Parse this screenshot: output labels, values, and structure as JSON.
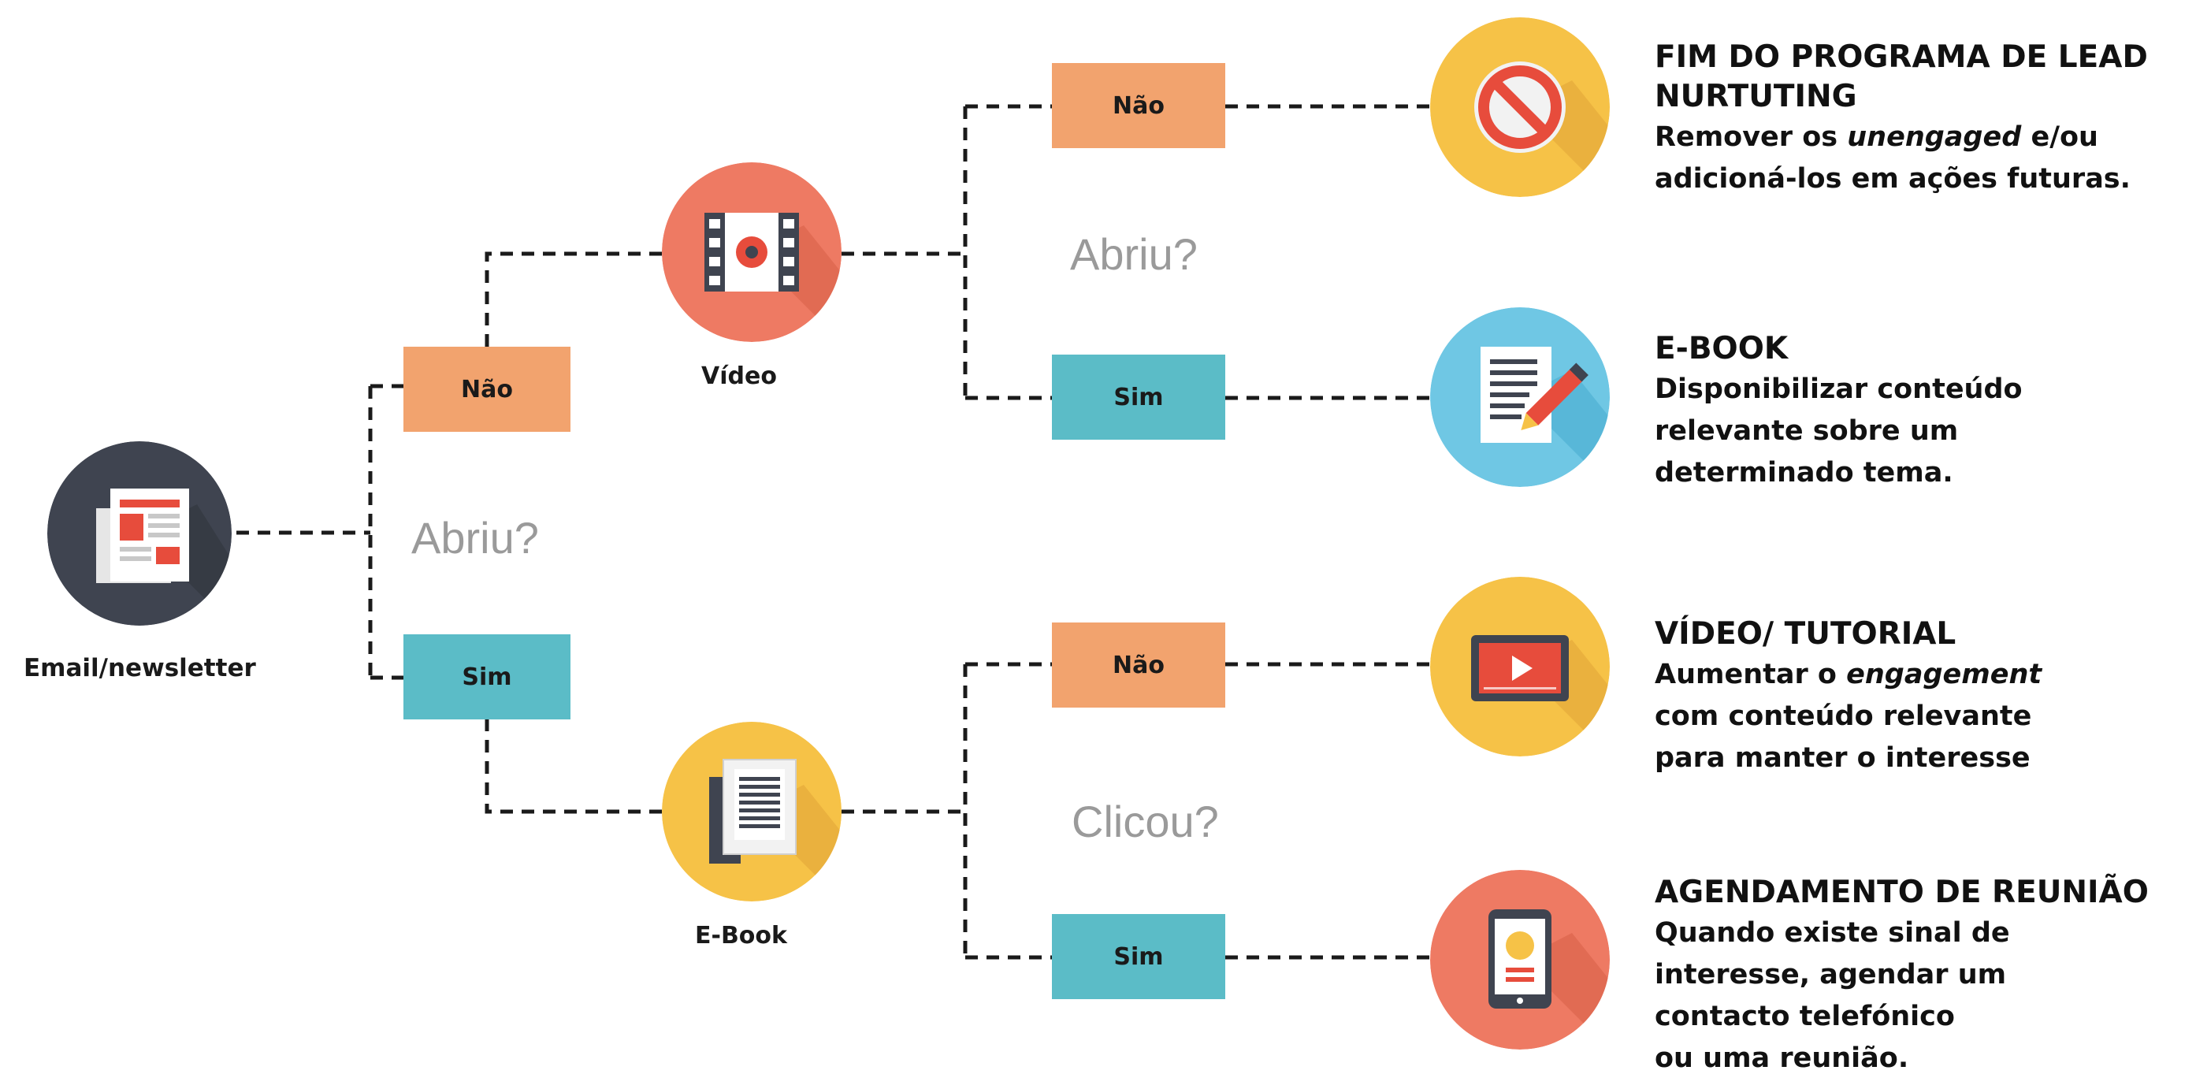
{
  "start": {
    "label": "Email/newsletter"
  },
  "nodes": {
    "video": {
      "label": "Vídeo"
    },
    "ebook": {
      "label": "E-Book"
    }
  },
  "questions": {
    "q1": "Abriu?",
    "q2": "Abriu?",
    "q3": "Clicou?"
  },
  "branches": {
    "level1_no": "Não",
    "level1_yes": "Sim",
    "video_no": "Não",
    "video_yes": "Sim",
    "ebook_no": "Não",
    "ebook_yes": "Sim"
  },
  "outcomes": [
    {
      "title_lines": [
        "FIM DO PROGRAMA DE LEAD",
        "NURTUTING"
      ],
      "desc_pre": "Remover os ",
      "desc_em": "unengaged",
      "desc_post": " e/ou",
      "desc_lines": [
        "adicioná-los em ações futuras."
      ],
      "icon": "prohibited-icon",
      "color": "#f6c247"
    },
    {
      "title_lines": [
        "E-BOOK"
      ],
      "desc_pre": "",
      "desc_em": "",
      "desc_post": "",
      "desc_lines": [
        "Disponibilizar conteúdo",
        "relevante sobre um",
        "determinado tema."
      ],
      "icon": "document-pencil-icon",
      "color": "#6fc7e4"
    },
    {
      "title_lines": [
        "VÍDEO/ TUTORIAL"
      ],
      "desc_pre": "Aumentar o ",
      "desc_em": "engagement",
      "desc_post": "",
      "desc_lines": [
        "com conteúdo relevante",
        "para manter o interesse"
      ],
      "icon": "video-player-icon",
      "color": "#f6c247"
    },
    {
      "title_lines": [
        "AGENDAMENTO DE REUNIÃO"
      ],
      "desc_pre": "",
      "desc_em": "",
      "desc_post": "",
      "desc_lines": [
        "Quando existe sinal de",
        "interesse, agendar um",
        "contacto telefónico",
        "ou uma reunião."
      ],
      "icon": "tablet-icon",
      "color": "#ee7a63"
    }
  ],
  "colors": {
    "no_box": "#f2a36e",
    "yes_box": "#5bbcc7",
    "start_circle": "#3f4450",
    "video_circle": "#ee7a63",
    "ebook_circle": "#f6c247"
  }
}
